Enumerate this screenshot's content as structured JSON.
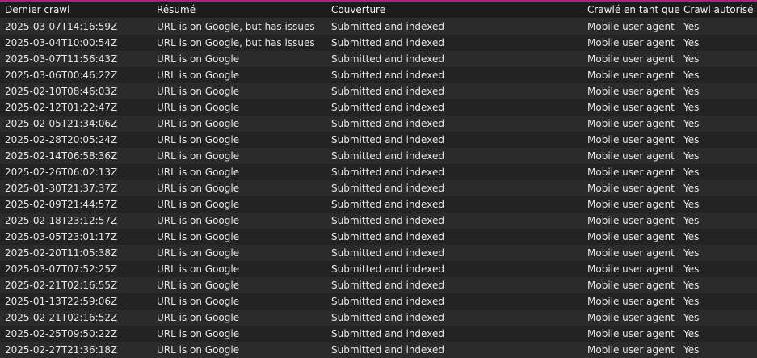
{
  "table": {
    "columns": [
      "Dernier crawl",
      "Résumé",
      "Couverture",
      "Crawlé en tant que",
      "Crawl autorisé"
    ],
    "rows": [
      [
        "2025-03-07T14:16:59Z",
        "URL is on Google, but has issues",
        "Submitted and indexed",
        "Mobile user agent",
        "Yes"
      ],
      [
        "2025-03-04T10:00:54Z",
        "URL is on Google, but has issues",
        "Submitted and indexed",
        "Mobile user agent",
        "Yes"
      ],
      [
        "2025-03-07T11:56:43Z",
        "URL is on Google",
        "Submitted and indexed",
        "Mobile user agent",
        "Yes"
      ],
      [
        "2025-03-06T00:46:22Z",
        "URL is on Google",
        "Submitted and indexed",
        "Mobile user agent",
        "Yes"
      ],
      [
        "2025-02-10T08:46:03Z",
        "URL is on Google",
        "Submitted and indexed",
        "Mobile user agent",
        "Yes"
      ],
      [
        "2025-02-12T01:22:47Z",
        "URL is on Google",
        "Submitted and indexed",
        "Mobile user agent",
        "Yes"
      ],
      [
        "2025-02-05T21:34:06Z",
        "URL is on Google",
        "Submitted and indexed",
        "Mobile user agent",
        "Yes"
      ],
      [
        "2025-02-28T20:05:24Z",
        "URL is on Google",
        "Submitted and indexed",
        "Mobile user agent",
        "Yes"
      ],
      [
        "2025-02-14T06:58:36Z",
        "URL is on Google",
        "Submitted and indexed",
        "Mobile user agent",
        "Yes"
      ],
      [
        "2025-02-26T06:02:13Z",
        "URL is on Google",
        "Submitted and indexed",
        "Mobile user agent",
        "Yes"
      ],
      [
        "2025-01-30T21:37:37Z",
        "URL is on Google",
        "Submitted and indexed",
        "Mobile user agent",
        "Yes"
      ],
      [
        "2025-02-09T21:44:57Z",
        "URL is on Google",
        "Submitted and indexed",
        "Mobile user agent",
        "Yes"
      ],
      [
        "2025-02-18T23:12:57Z",
        "URL is on Google",
        "Submitted and indexed",
        "Mobile user agent",
        "Yes"
      ],
      [
        "2025-03-05T23:01:17Z",
        "URL is on Google",
        "Submitted and indexed",
        "Mobile user agent",
        "Yes"
      ],
      [
        "2025-02-20T11:05:38Z",
        "URL is on Google",
        "Submitted and indexed",
        "Mobile user agent",
        "Yes"
      ],
      [
        "2025-03-07T07:52:25Z",
        "URL is on Google",
        "Submitted and indexed",
        "Mobile user agent",
        "Yes"
      ],
      [
        "2025-02-21T02:16:55Z",
        "URL is on Google",
        "Submitted and indexed",
        "Mobile user agent",
        "Yes"
      ],
      [
        "2025-01-13T22:59:06Z",
        "URL is on Google",
        "Submitted and indexed",
        "Mobile user agent",
        "Yes"
      ],
      [
        "2025-02-21T02:16:52Z",
        "URL is on Google",
        "Submitted and indexed",
        "Mobile user agent",
        "Yes"
      ],
      [
        "2025-02-25T09:50:22Z",
        "URL is on Google",
        "Submitted and indexed",
        "Mobile user agent",
        "Yes"
      ],
      [
        "2025-02-27T21:36:18Z",
        "URL is on Google",
        "Submitted and indexed",
        "Mobile user agent",
        "Yes"
      ]
    ]
  },
  "colors": {
    "accent": "#b01c8a",
    "row_odd": "#2b2b2b",
    "row_even": "#232323",
    "text": "#e6e6e6"
  }
}
